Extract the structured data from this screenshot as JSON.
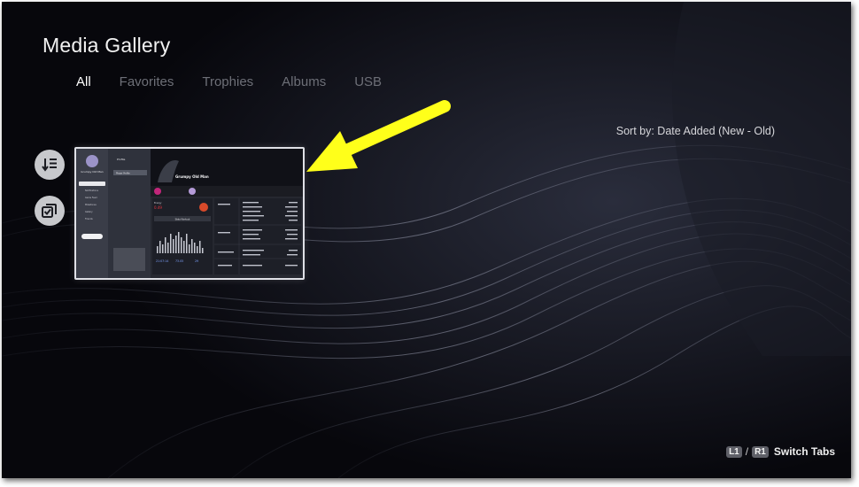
{
  "page": {
    "title": "Media Gallery"
  },
  "tabs": [
    {
      "label": "All",
      "active": true
    },
    {
      "label": "Favorites",
      "active": false
    },
    {
      "label": "Trophies",
      "active": false
    },
    {
      "label": "Albums",
      "active": false
    },
    {
      "label": "USB",
      "active": false
    }
  ],
  "sort": {
    "label": "Sort by: Date Added (New - Old)"
  },
  "side_buttons": [
    {
      "icon": "sort-list-icon"
    },
    {
      "icon": "multi-select-icon"
    }
  ],
  "thumbnail": {
    "profile_name": "Grumpy Old Man",
    "profile_heading": "Profile",
    "player_profile": "Player Profile",
    "sidebar_items": [
      "Notifications",
      "Game Feed",
      "Milestones",
      "Gallery",
      "Friends"
    ],
    "stats_heading": "Stats Workout",
    "stat_values": [
      "21:07:14",
      "73.05",
      "29"
    ]
  },
  "annotation": {
    "arrow_color": "#ffff1a"
  },
  "hint": {
    "l1": "L1",
    "separator": "/",
    "r1": "R1",
    "label": "Switch Tabs"
  }
}
